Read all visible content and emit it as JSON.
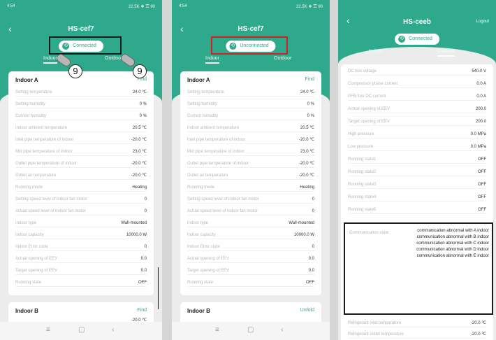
{
  "phones": [
    {
      "status_left": "4:54",
      "status_right": "22.5K ❖ ☰ 90",
      "title": "HS-cef7",
      "connection": "Connected",
      "tabs": [
        "Indoor",
        "Outdoor"
      ],
      "card": {
        "name": "Indoor A",
        "button": "Find",
        "rows": [
          [
            "Setting temperature",
            "24.0 ℃"
          ],
          [
            "Setting humidity",
            "0 %"
          ],
          [
            "Current humidity",
            "0 %"
          ],
          [
            "Indoor ambient temperature",
            "20.5 ℃"
          ],
          [
            "Inlet pipe temperature of indoor",
            "-20.0 ℃"
          ],
          [
            "Mid pipe temperature of indoor",
            "23.0 ℃"
          ],
          [
            "Outlet pipe temperature of indoor",
            "-20.0 ℃"
          ],
          [
            "Outlet air temperature",
            "-20.0 ℃"
          ],
          [
            "Running mode",
            "Heating"
          ],
          [
            "Setting speed level of indoor fan motor",
            "0"
          ],
          [
            "Actual speed level of indoor fan motor",
            "0"
          ],
          [
            "Indoor type",
            "Wall-mounted"
          ],
          [
            "Indoor capacity",
            "10000.0 W"
          ],
          [
            "Indoor Error code",
            "0"
          ],
          [
            "Actual opening of EEV",
            "0.0"
          ],
          [
            "Target opening of EEV",
            "0.0"
          ],
          [
            "Running state",
            "OFF"
          ]
        ]
      },
      "card_b": {
        "name": "Indoor B",
        "button": "Find",
        "value": "-20.0 ℃"
      },
      "badge": "9"
    },
    {
      "status_left": "4:54",
      "status_right": "22.5K ❖ ☰ 90",
      "title": "HS-cef7",
      "connection": "Unconnected",
      "tabs": [
        "Indoor",
        "Outdoor"
      ],
      "card": {
        "name": "Indoor A",
        "button": "Find",
        "rows": [
          [
            "Setting temperature",
            "24.0 ℃"
          ],
          [
            "Setting humidity",
            "0 %"
          ],
          [
            "Current humidity",
            "0 %"
          ],
          [
            "Indoor ambient temperature",
            "20.5 ℃"
          ],
          [
            "Inlet pipe temperature of indoor",
            "-20.0 ℃"
          ],
          [
            "Mid pipe temperature of indoor",
            "23.0 ℃"
          ],
          [
            "Outlet pipe temperature of indoor",
            "-20.0 ℃"
          ],
          [
            "Outlet air temperature",
            "-20.0 ℃"
          ],
          [
            "Running mode",
            "Heating"
          ],
          [
            "Setting speed level of indoor fan motor",
            "0"
          ],
          [
            "Actual speed level of indoor fan motor",
            "0"
          ],
          [
            "Indoor type",
            "Wall-mounted"
          ],
          [
            "Indoor capacity",
            "10000.0 W"
          ],
          [
            "Indoor Error code",
            "0"
          ],
          [
            "Actual opening of EEV",
            "0.0"
          ],
          [
            "Target opening of EEV",
            "0.0"
          ],
          [
            "Running state",
            "OFF"
          ]
        ]
      },
      "card_b": {
        "name": "Indoor B",
        "button": "Unfold"
      }
    },
    {
      "title": "HS-ceeb",
      "logout": "Logout",
      "connection": "Connected",
      "tabs": [
        "Indoor",
        "Outdoor"
      ],
      "rows": [
        [
          "DC bus voltage",
          "540.0 V"
        ],
        [
          "Compressor phase current",
          "0.0 A"
        ],
        [
          "PFB fore DC current",
          "0.0 A"
        ],
        [
          "Actual opening of EEV",
          "200.0"
        ],
        [
          "Target opening of EEV",
          "200.0"
        ],
        [
          "High pressure",
          "0.0 MPa"
        ],
        [
          "Low pressure",
          "0.0 MPa"
        ],
        [
          "Running state1",
          "OFF"
        ],
        [
          "Running state2",
          "OFF"
        ],
        [
          "Running state3",
          "OFF"
        ],
        [
          "Running state4",
          "OFF"
        ],
        [
          "Running state5",
          "OFF"
        ]
      ],
      "error": {
        "label": "Communication state",
        "lines": [
          "communication abnormal with A indoor",
          "communication abnormal with B indoor",
          "communication abnormal with C indoor",
          "communication abnormal with D indoor",
          "communication abnormal with E indoor"
        ]
      },
      "rows_after": [
        [
          "Refrigerant inlet temperature",
          "-20.0 ℃"
        ],
        [
          "Refrigerant outlet temperature",
          "-20.0 ℃"
        ]
      ]
    }
  ],
  "colors": {
    "accent": "#2fa98c",
    "highlight_red": "#d42020"
  },
  "icons": [
    "back-icon",
    "connection-icon",
    "menu-icon",
    "home-icon",
    "nav-back-icon",
    "hand-pointer-icon"
  ]
}
